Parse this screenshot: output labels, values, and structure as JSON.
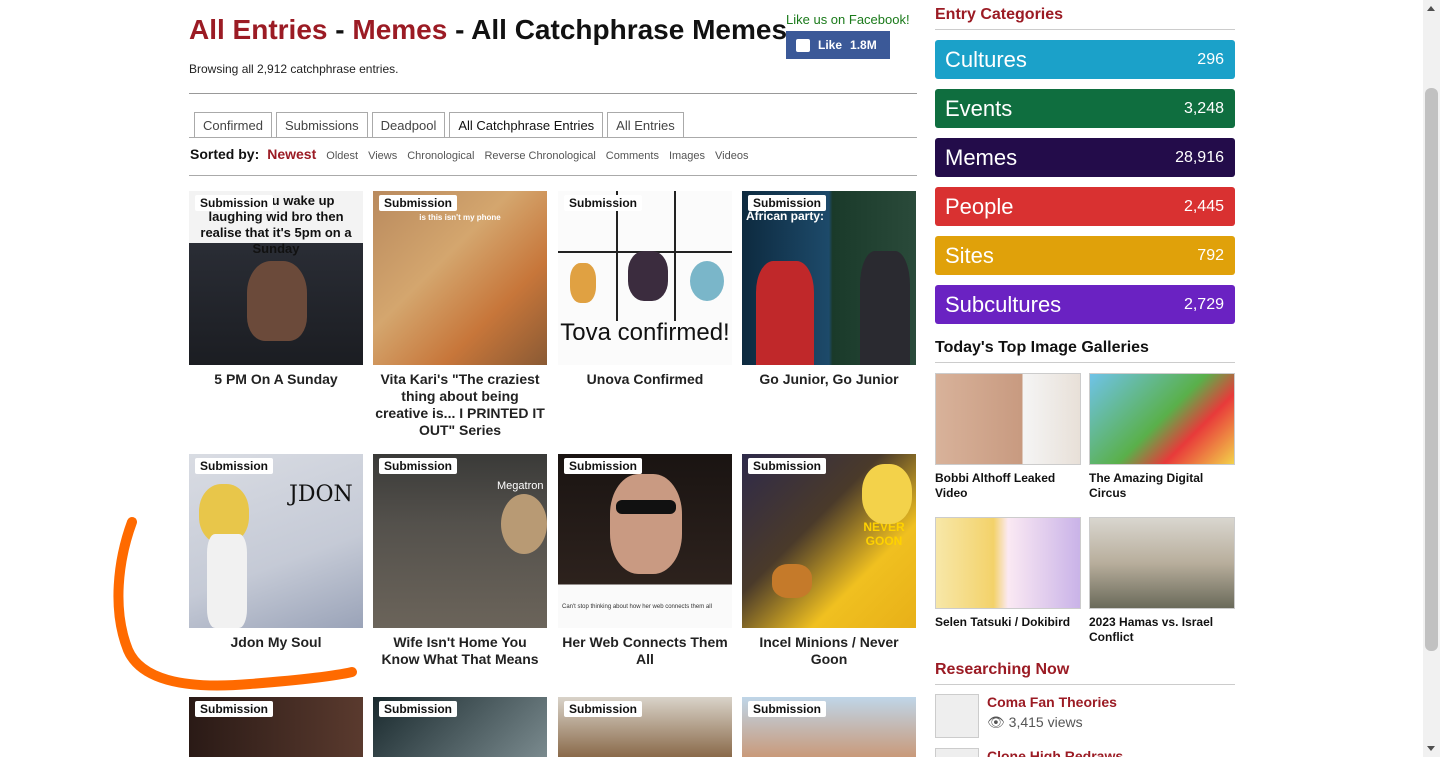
{
  "header": {
    "title_part1": "All Entries",
    "sep1": " - ",
    "title_part2": "Memes",
    "sep2": " - ",
    "title_part3": "All Catchphrase Memes",
    "browsing": "Browsing all 2,912 catchphrase entries.",
    "facebook": {
      "label": "Like us on Facebook!",
      "like": "Like",
      "count": "1.8M"
    }
  },
  "tabs": [
    "Confirmed",
    "Submissions",
    "Deadpool",
    "All Catchphrase Entries",
    "All Entries"
  ],
  "sort": {
    "label": "Sorted by:",
    "active": "Newest",
    "options": [
      "Oldest",
      "Views",
      "Chronological",
      "Reverse Chronological",
      "Comments",
      "Images",
      "Videos"
    ]
  },
  "entries": [
    {
      "badge": "Submission",
      "title": "5 PM On A Sunday",
      "overlay": "When you wake up laughing wid bro then realise that it's 5pm on a Sunday"
    },
    {
      "badge": "Submission",
      "title": "Vita Kari's \"The craziest thing about being creative is... I PRINTED IT OUT\" Series",
      "overlay": "is this isn't my phone"
    },
    {
      "badge": "Submission",
      "title": "Unova Confirmed",
      "overlay": "Tova confirmed!"
    },
    {
      "badge": "Submission",
      "title": "Go Junior, Go Junior",
      "overlay": "African party:"
    },
    {
      "badge": "Submission",
      "title": "Jdon My Soul",
      "overlay": "JDON"
    },
    {
      "badge": "Submission",
      "title": "Wife Isn't Home You Know What That Means",
      "overlay": "Megatron on d"
    },
    {
      "badge": "Submission",
      "title": "Her Web Connects Them All",
      "overlay": "Can't stop thinking about how her web connects them all"
    },
    {
      "badge": "Submission",
      "title": "Incel Minions / Never Goon",
      "overlay": "NEVER GOON"
    },
    {
      "badge": "Submission",
      "title": "",
      "overlay": ""
    },
    {
      "badge": "Submission",
      "title": "",
      "overlay": ""
    },
    {
      "badge": "Submission",
      "title": "",
      "overlay": ""
    },
    {
      "badge": "Submission",
      "title": "",
      "overlay": ""
    }
  ],
  "sidebar": {
    "categories_heading": "Entry Categories",
    "categories": [
      {
        "name": "Cultures",
        "count": "296",
        "color": "#1ba1c9"
      },
      {
        "name": "Events",
        "count": "3,248",
        "color": "#0f6e3f"
      },
      {
        "name": "Memes",
        "count": "28,916",
        "color": "#230c4a"
      },
      {
        "name": "People",
        "count": "2,445",
        "color": "#d93131"
      },
      {
        "name": "Sites",
        "count": "792",
        "color": "#e0a10a"
      },
      {
        "name": "Subcultures",
        "count": "2,729",
        "color": "#6a22c2"
      }
    ],
    "galleries_heading": "Today's Top Image Galleries",
    "galleries": [
      {
        "title": "Bobbi Althoff Leaked Video"
      },
      {
        "title": "The Amazing Digital Circus"
      },
      {
        "title": "Selen Tatsuki / Dokibird"
      },
      {
        "title": "2023 Hamas vs. Israel Conflict"
      }
    ],
    "researching_heading": "Researching Now",
    "researching": [
      {
        "title": "Coma Fan Theories",
        "views": "3,415 views"
      },
      {
        "title": "Clone High Redraws",
        "views": ""
      }
    ]
  },
  "colors": {
    "accent": "#9b1b24",
    "facebook": "#3b5998",
    "annotation": "#ff6a00"
  }
}
